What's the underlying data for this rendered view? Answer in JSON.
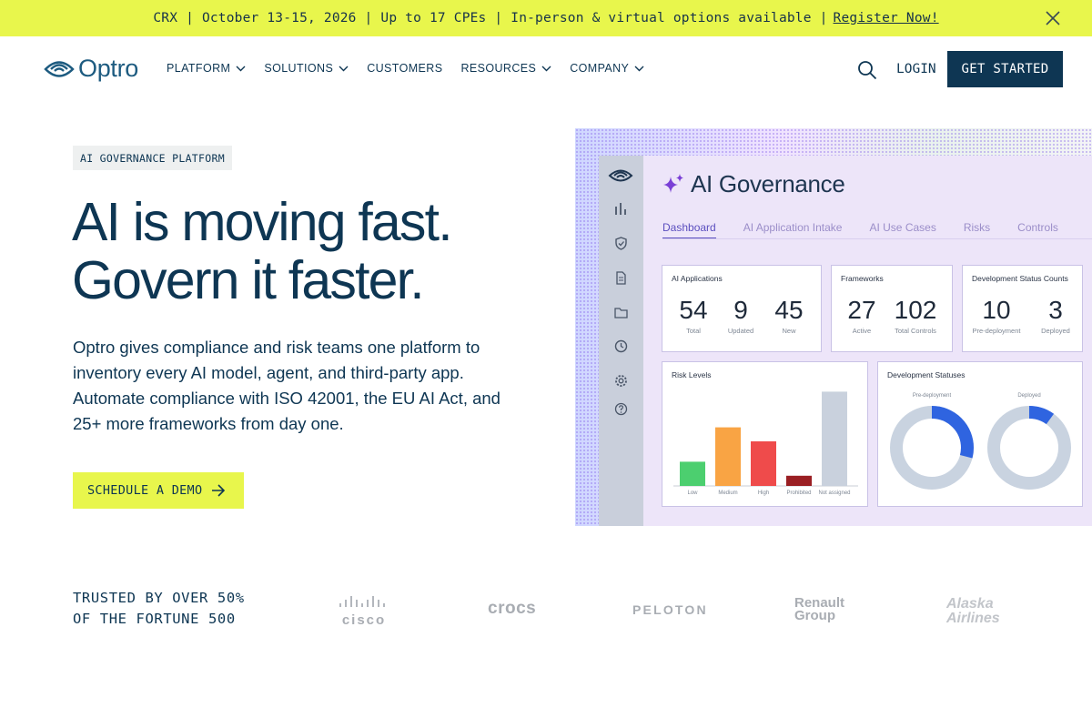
{
  "announcement": {
    "text": "CRX | October 13-15, 2026 | Up to 17 CPEs | In-person & virtual options available |",
    "link": "Register Now!"
  },
  "nav": {
    "brand": "Optro",
    "items": [
      {
        "label": "PLATFORM",
        "dropdown": true
      },
      {
        "label": "SOLUTIONS",
        "dropdown": true
      },
      {
        "label": "CUSTOMERS",
        "dropdown": false
      },
      {
        "label": "RESOURCES",
        "dropdown": true
      },
      {
        "label": "COMPANY",
        "dropdown": true
      }
    ],
    "login": "LOGIN",
    "cta": "GET STARTED"
  },
  "hero": {
    "eyebrow": "AI GOVERNANCE PLATFORM",
    "title_line1": "AI is moving fast.",
    "title_line2": "Govern it faster.",
    "lead": "Optro gives compliance and risk teams one platform to inventory every AI model, agent, and third-party app. Automate compliance with ISO 42001, the EU AI Act, and 25+ more frameworks from day one.",
    "cta": "SCHEDULE A DEMO"
  },
  "dashboard": {
    "title": "AI Governance",
    "tabs": [
      "Dashboard",
      "AI Application Intake",
      "AI Use Cases",
      "Risks",
      "Controls"
    ],
    "cards": {
      "ai_applications": {
        "title": "AI Applications",
        "stats": [
          {
            "n": "54",
            "l": "Total"
          },
          {
            "n": "9",
            "l": "Updated"
          },
          {
            "n": "45",
            "l": "New"
          }
        ]
      },
      "frameworks": {
        "title": "Frameworks",
        "stats": [
          {
            "n": "27",
            "l": "Active"
          },
          {
            "n": "102",
            "l": "Total Controls"
          }
        ]
      },
      "dev_status_counts": {
        "title": "Development Status Counts",
        "stats": [
          {
            "n": "10",
            "l": "Pre-deployment"
          },
          {
            "n": "3",
            "l": "Deployed"
          }
        ]
      },
      "risk_levels": {
        "title": "Risk Levels",
        "bars": [
          {
            "label": "Low",
            "value": 0.19,
            "color": "#4ccf6f"
          },
          {
            "label": "Medium",
            "value": 0.46,
            "color": "#f9a444"
          },
          {
            "label": "High",
            "value": 0.35,
            "color": "#ef4b4b"
          },
          {
            "label": "Prohibited",
            "value": 0.08,
            "color": "#9a1f23"
          },
          {
            "label": "Not assigned",
            "value": 0.74,
            "color": "#c9d1dd"
          }
        ]
      },
      "dev_statuses": {
        "title": "Development Statuses",
        "donuts": [
          {
            "label": "Pre-deployment",
            "fraction": 0.29
          },
          {
            "label": "Deployed",
            "fraction": 0.1
          }
        ]
      }
    }
  },
  "trusted": {
    "line1": "TRUSTED BY OVER 50%",
    "line2": "OF THE FORTUNE 500",
    "logos": [
      "cisco",
      "crocs",
      "PELOTON",
      "Renault Group",
      "Alaska Airlines"
    ]
  }
}
